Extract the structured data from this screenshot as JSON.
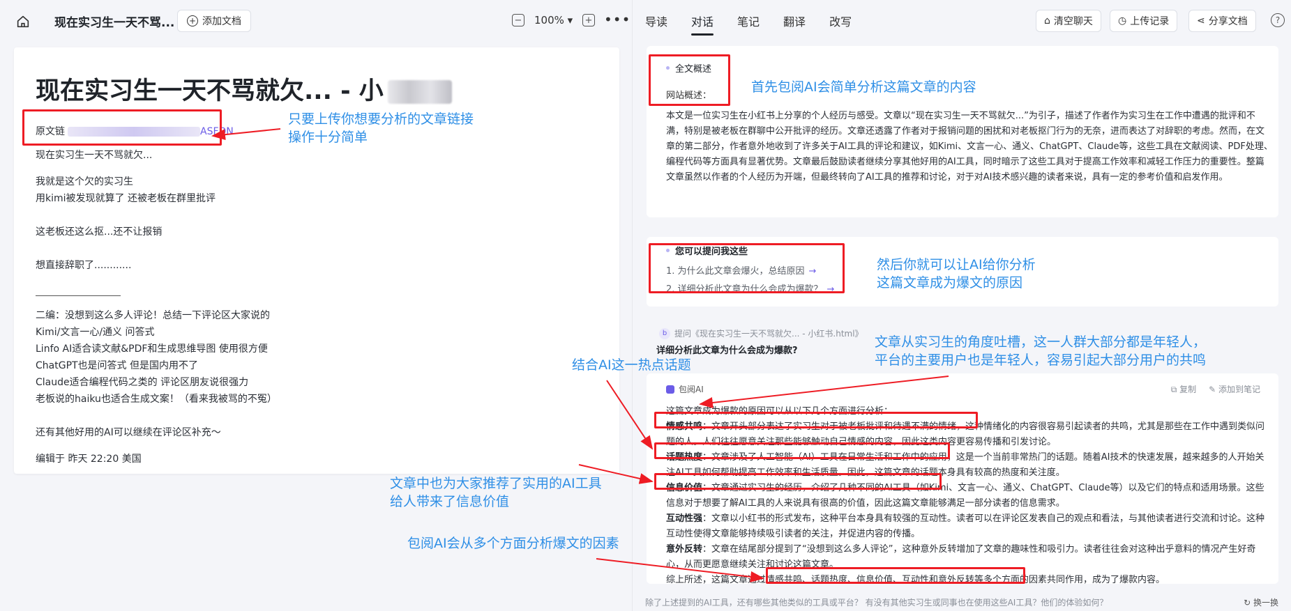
{
  "left": {
    "home_icon": "home-icon",
    "doc_tab_title": "现在实习生一天不骂...",
    "add_doc_label": "添加文档",
    "zoom": "100%",
    "zoom_dropdown": "▾",
    "doc": {
      "heading": "现在实习生一天不骂就欠... - 小",
      "source_label": "原文链",
      "source_tail": "ASFDN",
      "lines": [
        "现在实习生一天不骂就欠...",
        "我就是这个欠的实习生",
        "用kimi被发现就算了 还被老板在群里批评",
        "这老板还这么抠...还不让报销",
        "想直接辞职了............",
        "二编：没想到这么多人评论！总结一下评论区大家说的",
        "Kimi/文言一心/通义 问答式",
        "Linfo AI适合读文献&PDF和生成思维导图 使用很方便",
        "ChatGPT也是问答式 但是国内用不了",
        "Claude适合编程代码之类的 评论区朋友说很强力",
        "老板说的haiku也适合生成文案！（看来我被骂的不冤）",
        "还有其他好用的AI可以继续在评论区补充～",
        "编辑于 昨天 22:20 美国"
      ]
    }
  },
  "right": {
    "tabs": [
      "导读",
      "对话",
      "笔记",
      "翻译",
      "改写"
    ],
    "active_tab": "对话",
    "clear_chat": "清空聊天",
    "upload_record": "上传记录",
    "share_doc": "分享文档",
    "help": "?",
    "summary": {
      "title": "全文概述",
      "site_label": "网站概述：",
      "text": "本文是一位实习生在小红书上分享的个人经历与感受。文章以“现在实习生一天不骂就欠...”为引子，描述了作者作为实习生在工作中遭遇的批评和不满，特别是被老板在群聊中公开批评的经历。文章还透露了作者对于报销问题的困扰和对老板抠门行为的无奈，进而表达了对辞职的考虑。然而，在文章的第二部分，作者意外地收到了许多关于AI工具的评论和建议，如Kimi、文言一心、通义、ChatGPT、Claude等，这些工具在文献阅读、PDF处理、编程代码等方面具有显著优势。文章最后鼓励读者继续分享其他好用的AI工具，同时暗示了这些工具对于提高工作效率和减轻工作压力的重要性。整篇文章虽然以作者的个人经历为开端，但最终转向了AI工具的推荐和讨论，对于对AI技术感兴趣的读者来说，具有一定的参考价值和启发作用。"
    },
    "questions": {
      "title": "您可以提问我这些",
      "items": [
        "1. 为什么此文章会爆火，总结原因",
        "2. 详细分析此文章为什么会成为爆款？"
      ],
      "arrow": "→"
    },
    "ask": {
      "badge": "b",
      "quote": "提问《现在实习生一天不骂就欠... - 小红书.html》",
      "question": "详细分析此文章为什么会成为爆款?"
    },
    "answer": {
      "author": "包阅AI",
      "copy": "复制",
      "add_note": "添加到笔记",
      "intro": "这篇文章成为爆款的原因可以从以下几个方面进行分析：",
      "points": [
        {
          "label": "情感共鸣",
          "text": "：文章开头部分表达了实习生对于被老板批评和待遇不满的情绪，这种情绪化的内容很容易引起读者的共鸣，尤其是那些在工作中遇到类似问题的人。人们往往愿意关注那些能够触动自己情感的内容，因此这类内容更容易传播和引发讨论。"
        },
        {
          "label": "话题热度",
          "text": "：文章涉及了人工智能（AI）工具在日常生活和工作中的应用，这是一个当前非常热门的话题。随着AI技术的快速发展，越来越多的人开始关注AI工具如何帮助提高工作效率和生活质量。因此，这篇文章的话题本身具有较高的热度和关注度。"
        },
        {
          "label": "信息价值",
          "text": "：文章通过实习生的经历，介绍了几种不同的AI工具（如Kimi、文言一心、通义、ChatGPT、Claude等）以及它们的特点和适用场景。这些信息对于想要了解AI工具的人来说具有很高的价值，因此这篇文章能够满足一部分读者的信息需求。"
        },
        {
          "label": "互动性强",
          "text": "：文章以小红书的形式发布，这种平台本身具有较强的互动性。读者可以在评论区发表自己的观点和看法，与其他读者进行交流和讨论。这种互动性使得文章能够持续吸引读者的关注，并促进内容的传播。"
        },
        {
          "label": "意外反转",
          "text": "：文章在结尾部分提到了“没想到这么多人评论”，这种意外反转增加了文章的趣味性和吸引力。读者往往会对这种出乎意料的情况产生好奇心，从而更愿意继续关注和讨论这篇文章。"
        }
      ],
      "conclusion": "综上所述，这篇文章通过情感共鸣、话题热度、信息价值、互动性和意外反转等多个方面的因素共同作用，成为了爆款内容。"
    },
    "suggestion": "除了上述提到的AI工具，还有哪些其他类似的工具或平台？ 有没有其他实习生或同事也在使用这些AI工具？他们的体验如何？",
    "swap": "换一换"
  },
  "annotations": {
    "a1": [
      "只要上传你想要分析的文章链接",
      "操作十分简单"
    ],
    "a2": "首先包阅AI会简单分析这篇文章的内容",
    "a3": [
      "然后你就可以让AI给你分析",
      "这篇文章成为爆文的原因"
    ],
    "a4": [
      "文章从实习生的角度吐槽，这一人群大部分都是年轻人，",
      "平台的主要用户也是年轻人，容易引起大部分用户的共鸣"
    ],
    "a5": "结合AI这一热点话题",
    "a6": [
      "文章中也为大家推荐了实用的AI工具",
      "给人带来了信息价值"
    ],
    "a7": "包阅AI会从多个方面分析爆文的因素",
    "color_red": "#ee1c24",
    "color_blue": "#2f8fe6"
  }
}
